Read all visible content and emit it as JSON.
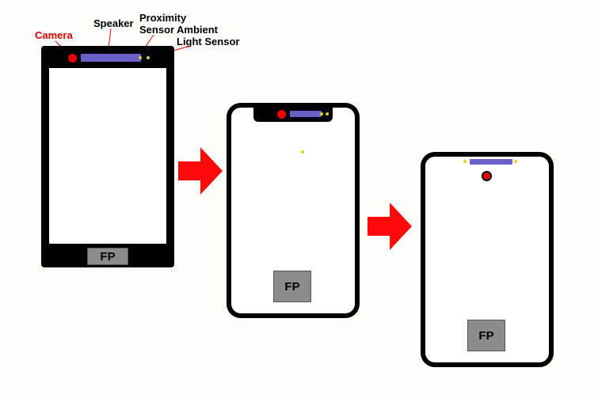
{
  "labels": {
    "camera": "Camera",
    "speaker": "Speaker",
    "proximity_line1": "Proximity",
    "proximity_line2": "Sensor",
    "ambient_line1": "Ambient",
    "ambient_line2": "Light Sensor"
  },
  "fp_label": "FP",
  "colors": {
    "camera": "#e00",
    "speaker": "#6b5fc9",
    "sensor": "#e0d020",
    "arrow": "#ff0a0a",
    "fp_bg": "#8c8c8c"
  }
}
